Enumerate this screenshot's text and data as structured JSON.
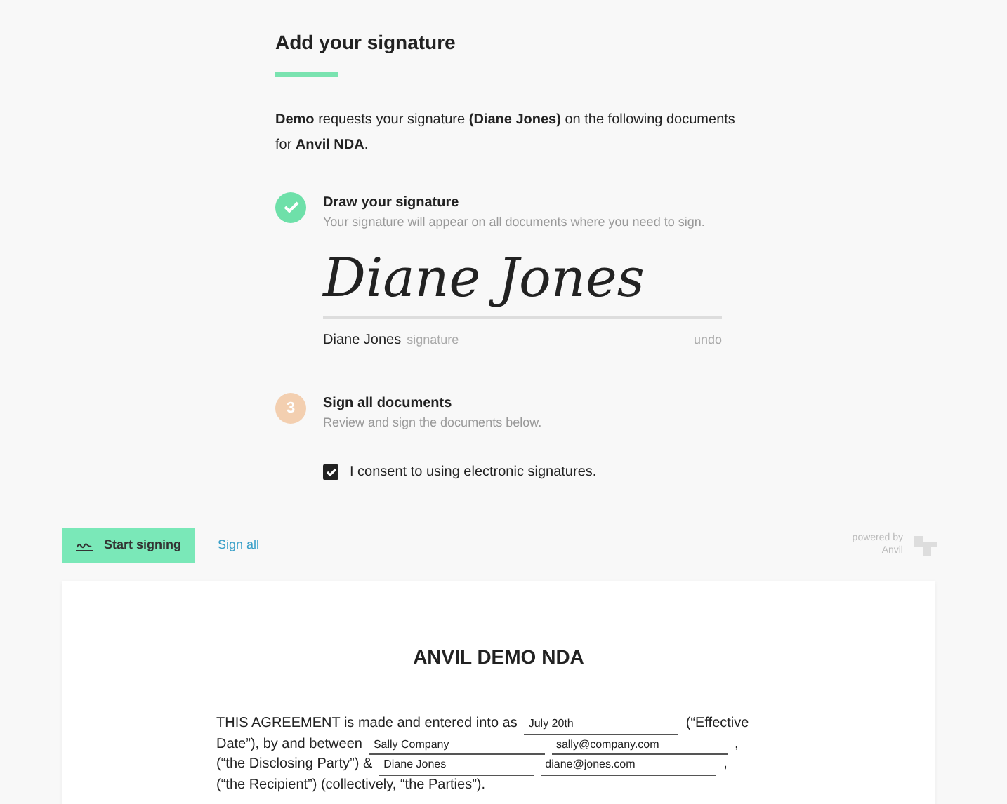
{
  "heading": "Add your signature",
  "intro": "**Demo** requests your signature **(Diane Jones)** on the following documents for **Anvil NDA**.",
  "steps": [
    {
      "kind": "done",
      "title": "Draw your signature",
      "subtitle": "Your signature will appear on all documents where you need to sign."
    },
    {
      "kind": "pending",
      "number": "3",
      "title": "Sign all documents",
      "subtitle": "Review and sign the documents below."
    }
  ],
  "signature": {
    "drawn": "Diane Jones",
    "name": "Diane Jones",
    "caption": "signature",
    "undo": "undo"
  },
  "consent": {
    "label": "I consent to using electronic signatures.",
    "checked": true
  },
  "toolbar": {
    "start": "Start signing",
    "sign_all": "Sign all",
    "powered": "powered by",
    "brand": "Anvil"
  },
  "document": {
    "title": "ANVIL DEMO NDA",
    "lines": [
      [
        {
          "kind": "text",
          "text": "THIS AGREEMENT is made and entered into as"
        },
        {
          "kind": "field",
          "text": "July 20th"
        },
        {
          "kind": "text",
          "text": "(“Effective"
        }
      ],
      [
        {
          "kind": "text",
          "text": "Date”), by and between"
        },
        {
          "kind": "field",
          "text": "Sally Company"
        },
        {
          "kind": "field",
          "text": "sally@company.com"
        },
        {
          "kind": "text",
          "text": ","
        }
      ],
      [
        {
          "kind": "text",
          "text": "(“the Disclosing Party”) &"
        },
        {
          "kind": "field",
          "text": "Diane Jones"
        },
        {
          "kind": "field",
          "text": "diane@jones.com"
        },
        {
          "kind": "text",
          "text": ","
        }
      ],
      [
        {
          "kind": "text",
          "text": "(“the Recipient”) (collectively, “the Parties”)."
        }
      ]
    ]
  }
}
